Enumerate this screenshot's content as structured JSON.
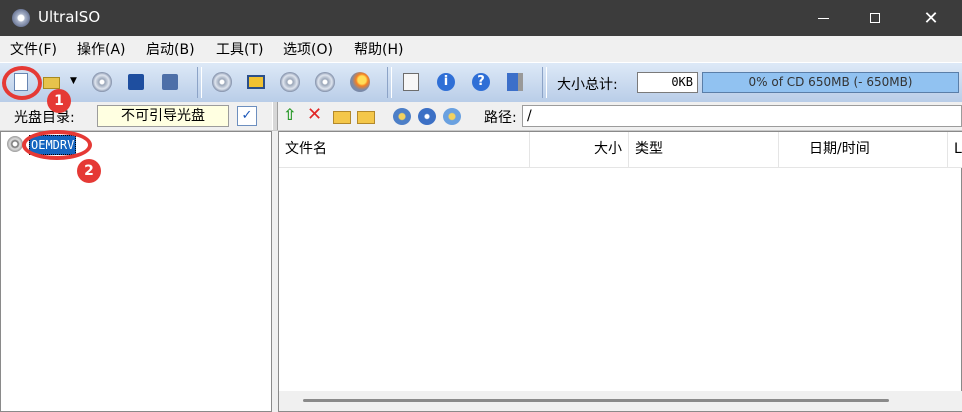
{
  "window": {
    "title": "UltraISO"
  },
  "menu": [
    "文件(F)",
    "操作(A)",
    "启动(B)",
    "工具(T)",
    "选项(O)",
    "帮助(H)"
  ],
  "toolbar": {
    "total_size_label": "大小总计:",
    "total_size_value": "0KB",
    "capacity_text": "0% of CD 650MB (- 650MB)",
    "capacity_percent": 0
  },
  "image_bar": {
    "disc_dir_label": "光盘目录:",
    "boot_status": "不可引导光盘",
    "path_label": "路径:",
    "path_value": "/"
  },
  "tree": {
    "root_label": "OEMDRV"
  },
  "file_list": {
    "columns": [
      "文件名",
      "大小",
      "类型",
      "日期/时间",
      "L"
    ]
  },
  "annotations": [
    "1",
    "2"
  ],
  "colors": {
    "callout": "#e53935",
    "selection": "#1565c0",
    "toolbar_top": "#dde9f7"
  }
}
